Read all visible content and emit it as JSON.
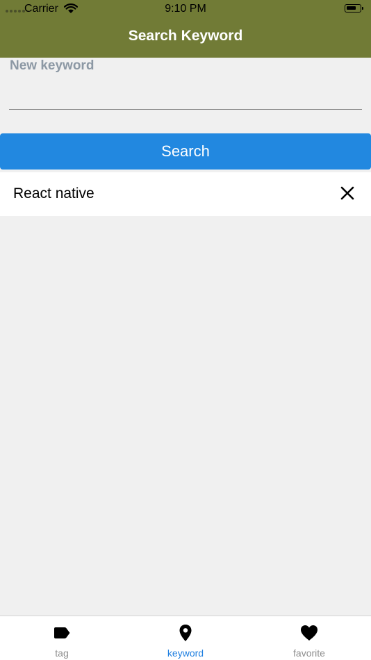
{
  "status_bar": {
    "carrier": "Carrier",
    "time": "9:10 PM"
  },
  "header": {
    "title": "Search Keyword"
  },
  "form": {
    "label": "New keyword",
    "input_value": "",
    "search_label": "Search"
  },
  "keywords": [
    {
      "label": "React native"
    }
  ],
  "tabs": [
    {
      "label": "tag",
      "icon": "tag-icon",
      "active": false
    },
    {
      "label": "keyword",
      "icon": "map-pin-icon",
      "active": true
    },
    {
      "label": "favorite",
      "icon": "heart-icon",
      "active": false
    }
  ],
  "colors": {
    "header_bg": "#717b36",
    "button_bg": "#2288e0",
    "active_tab": "#1f7fe0",
    "inactive_tab": "#8e8e8e",
    "label": "#8c98a4",
    "background": "#f0f0f0"
  }
}
